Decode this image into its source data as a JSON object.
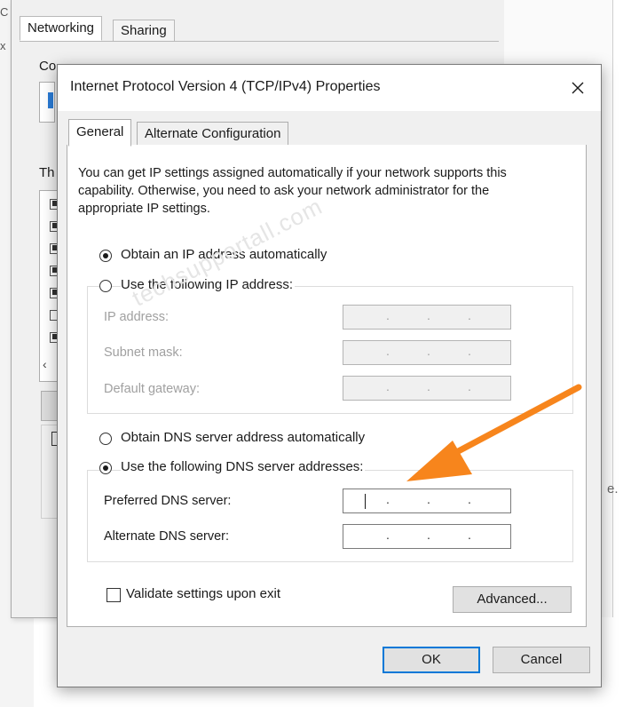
{
  "background_window": {
    "tabs": [
      {
        "label": "Networking",
        "selected": true
      },
      {
        "label": "Sharing",
        "selected": false
      }
    ],
    "connect_using_label": "Co",
    "this_connection_label": "Th",
    "left_edge_glyphs": [
      "C",
      "x"
    ],
    "right_edge_letter": "e.",
    "list_checked_states": [
      true,
      true,
      true,
      true,
      true,
      false,
      true
    ]
  },
  "dialog": {
    "title": "Internet Protocol Version 4 (TCP/IPv4) Properties",
    "tabs": [
      {
        "label": "General",
        "selected": true
      },
      {
        "label": "Alternate Configuration",
        "selected": false
      }
    ],
    "intro": "You can get IP settings assigned automatically if your network supports this capability. Otherwise, you need to ask your network administrator for the appropriate IP settings.",
    "ip_options": {
      "auto_label": "Obtain an IP address automatically",
      "manual_label": "Use the following IP address:",
      "selected": "auto"
    },
    "ip_fields": [
      {
        "label": "IP address:",
        "value": "",
        "enabled": false
      },
      {
        "label": "Subnet mask:",
        "value": "",
        "enabled": false
      },
      {
        "label": "Default gateway:",
        "value": "",
        "enabled": false
      }
    ],
    "dns_options": {
      "auto_label": "Obtain DNS server address automatically",
      "manual_label": "Use the following DNS server addresses:",
      "selected": "manual"
    },
    "dns_fields": [
      {
        "label": "Preferred DNS server:",
        "value": "",
        "enabled": true,
        "focused": true
      },
      {
        "label": "Alternate DNS server:",
        "value": "",
        "enabled": true,
        "focused": false
      }
    ],
    "validate_checkbox": {
      "label": "Validate settings upon exit",
      "checked": false
    },
    "buttons": {
      "advanced": "Advanced...",
      "ok": "OK",
      "cancel": "Cancel"
    }
  },
  "watermark": "techsupportall.com",
  "annotation": {
    "icon": "arrow-icon",
    "color": "#f7851c"
  },
  "colors": {
    "dialog_bg": "#f0f0f0",
    "accent_focus": "#0078d7",
    "arrow": "#f7851c"
  }
}
